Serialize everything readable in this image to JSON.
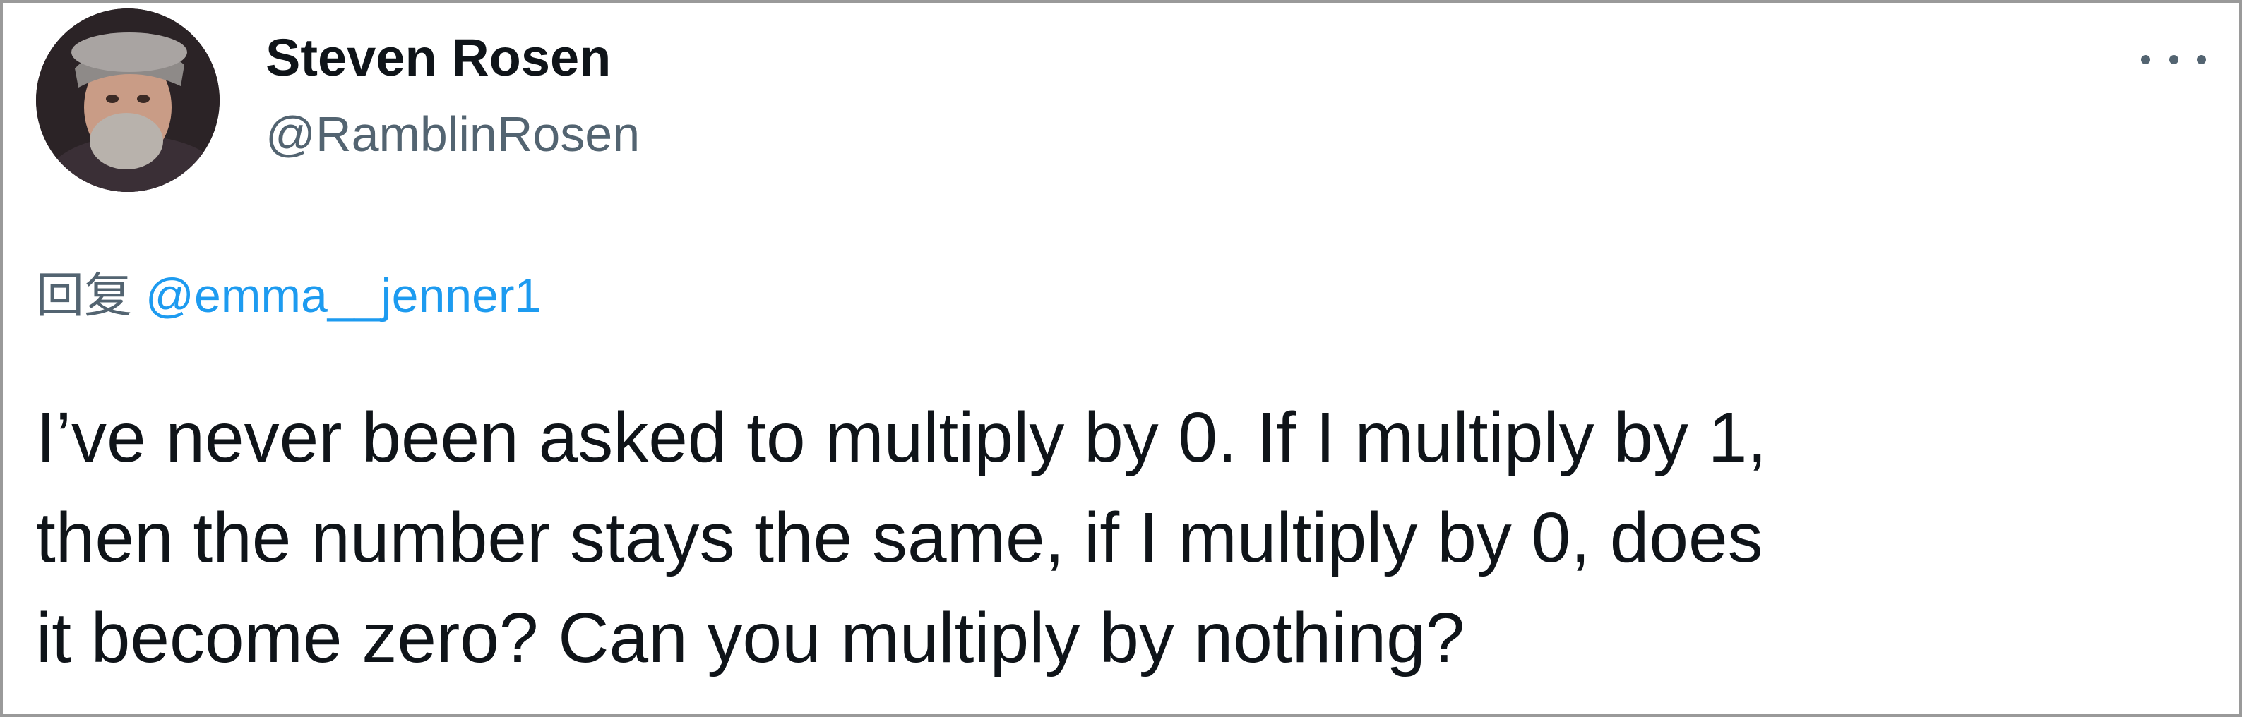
{
  "author": {
    "display_name": "Steven Rosen",
    "handle": "@RamblinRosen"
  },
  "menu": {
    "icon": "more-horizontal-icon"
  },
  "reply": {
    "prefix": "回复",
    "mention": "@emma__jenner1"
  },
  "tweet": {
    "text": "I’ve never been asked to multiply by 0. If I multiply by 1,\nthen the number stays the same, if I multiply by 0, does\nit become zero? Can you multiply by nothing?"
  },
  "colors": {
    "text_primary": "#0f1419",
    "text_secondary": "#536471",
    "link": "#1d9bf0",
    "border": "#9a9a9a"
  }
}
